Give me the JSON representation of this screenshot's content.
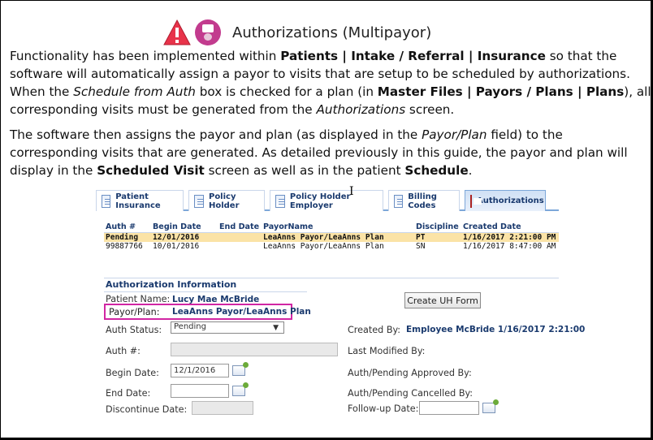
{
  "heading": {
    "title": "Authorizations (Multipayor)",
    "icons": [
      "warning-icon",
      "nurse-icon"
    ]
  },
  "para1": {
    "t1": "Functionality has been implemented within ",
    "b1": "Patients | Intake / Referral | Insurance",
    "t2": " so that the software will automatically assign a payor to visits that are setup to be scheduled by authorizations. When the ",
    "i1": "Schedule from Auth",
    "t3": " box is checked for a plan (in ",
    "b2": "Master Files | Payors / Plans | Plans",
    "t4": "), all corresponding visits must be generated from the ",
    "i2": "Authorizations",
    "t5": " screen."
  },
  "para2": {
    "t1": "The software then assigns the payor and plan (as displayed in the ",
    "i1": "Payor/Plan",
    "t2": " field) to the corresponding visits that are generated. As detailed previously in this guide, the payor and plan will display in the ",
    "b1": "Scheduled Visit",
    "t3": " screen as well as in the patient ",
    "b2": "Schedule",
    "t4": "."
  },
  "tabs": [
    "Patient Insurance",
    "Policy Holder",
    "Policy Holder Employer",
    "Billing Codes",
    "Authorizations"
  ],
  "grid": {
    "headers": [
      "Auth #",
      "Begin Date",
      "End Date",
      "PayorName",
      "Discipline",
      "Created Date"
    ],
    "rows": [
      [
        "Pending",
        "12/01/2016",
        "",
        "LeaAnns Payor/LeaAnns Plan",
        "PT",
        "1/16/2017 2:21:00 PM"
      ],
      [
        "99887766",
        "10/01/2016",
        "",
        "LeaAnns Payor/LeaAnns Plan",
        "SN",
        "1/16/2017 8:47:00 AM"
      ]
    ]
  },
  "auth_info": {
    "section_title": "Authorization Information",
    "patient_name_label": "Patient Name:",
    "patient_name": "Lucy Mae McBride",
    "payor_plan_label": "Payor/Plan:",
    "payor_plan": "LeaAnns Payor/LeaAnns Plan",
    "create_button": "Create UH Form",
    "auth_status_label": "Auth Status:",
    "auth_status": "Pending",
    "created_by_label": "Created By:",
    "created_by": "Employee McBride 1/16/2017 2:21:00",
    "auth_num_label": "Auth #:",
    "last_modified_label": "Last Modified By:",
    "begin_date_label": "Begin Date:",
    "begin_date": "12/1/2016",
    "approved_by_label": "Auth/Pending Approved By:",
    "end_date_label": "End Date:",
    "cancelled_by_label": "Auth/Pending Cancelled By:",
    "discontinue_label": "Discontinue Date:",
    "followup_label": "Follow-up Date:"
  }
}
